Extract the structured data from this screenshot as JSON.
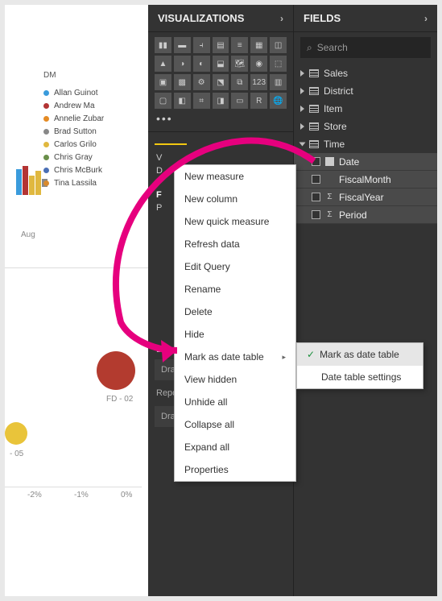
{
  "panes": {
    "visualizations": {
      "title": "VISUALIZATIONS"
    },
    "fields": {
      "title": "FIELDS"
    }
  },
  "search": {
    "placeholder": "Search"
  },
  "legend": {
    "title": "DM",
    "items": [
      {
        "label": "Allan Guinot",
        "color": "#3a9bdc"
      },
      {
        "label": "Andrew Ma",
        "color": "#b33434"
      },
      {
        "label": "Annelie Zubar",
        "color": "#e58b24"
      },
      {
        "label": "Brad Sutton",
        "color": "#888888"
      },
      {
        "label": "Carlos Grilo",
        "color": "#e0b83f"
      },
      {
        "label": "Chris Gray",
        "color": "#6a8f4a"
      },
      {
        "label": "Chris McBurk",
        "color": "#4a6fb5"
      },
      {
        "label": "Tina Lassila",
        "color": "#d88a2e"
      }
    ]
  },
  "axis": {
    "month": "Aug",
    "ticks": [
      "-2%",
      "-1%",
      "0%"
    ],
    "scatter_label1": "FD - 02",
    "scatter_label2": "- 05"
  },
  "tables": [
    {
      "label": "Sales",
      "expanded": false
    },
    {
      "label": "District",
      "expanded": false
    },
    {
      "label": "Item",
      "expanded": false
    },
    {
      "label": "Store",
      "expanded": false
    },
    {
      "label": "Time",
      "expanded": true
    }
  ],
  "time_fields": [
    {
      "label": "Date",
      "icon": "cal"
    },
    {
      "label": "FiscalMonth",
      "icon": "none"
    },
    {
      "label": "FiscalYear",
      "icon": "sigma"
    },
    {
      "label": "Period",
      "icon": "sigma"
    }
  ],
  "context_menu": [
    "New measure",
    "New column",
    "New quick measure",
    "Refresh data",
    "Edit Query",
    "Rename",
    "Delete",
    "Hide",
    "Mark as date table",
    "View hidden",
    "Unhide all",
    "Collapse all",
    "Expand all",
    "Properties"
  ],
  "submenu": {
    "mark": "Mark as date table",
    "settings": "Date table settings"
  },
  "placeholders": {
    "drillthrough": "Drag drillthrough fields here",
    "report_filters": "Report level filters",
    "data_fields": "Drag data fields here",
    "values_initial": "V",
    "drill_initial": "D",
    "format_initial": "F",
    "page_initial": "P"
  }
}
